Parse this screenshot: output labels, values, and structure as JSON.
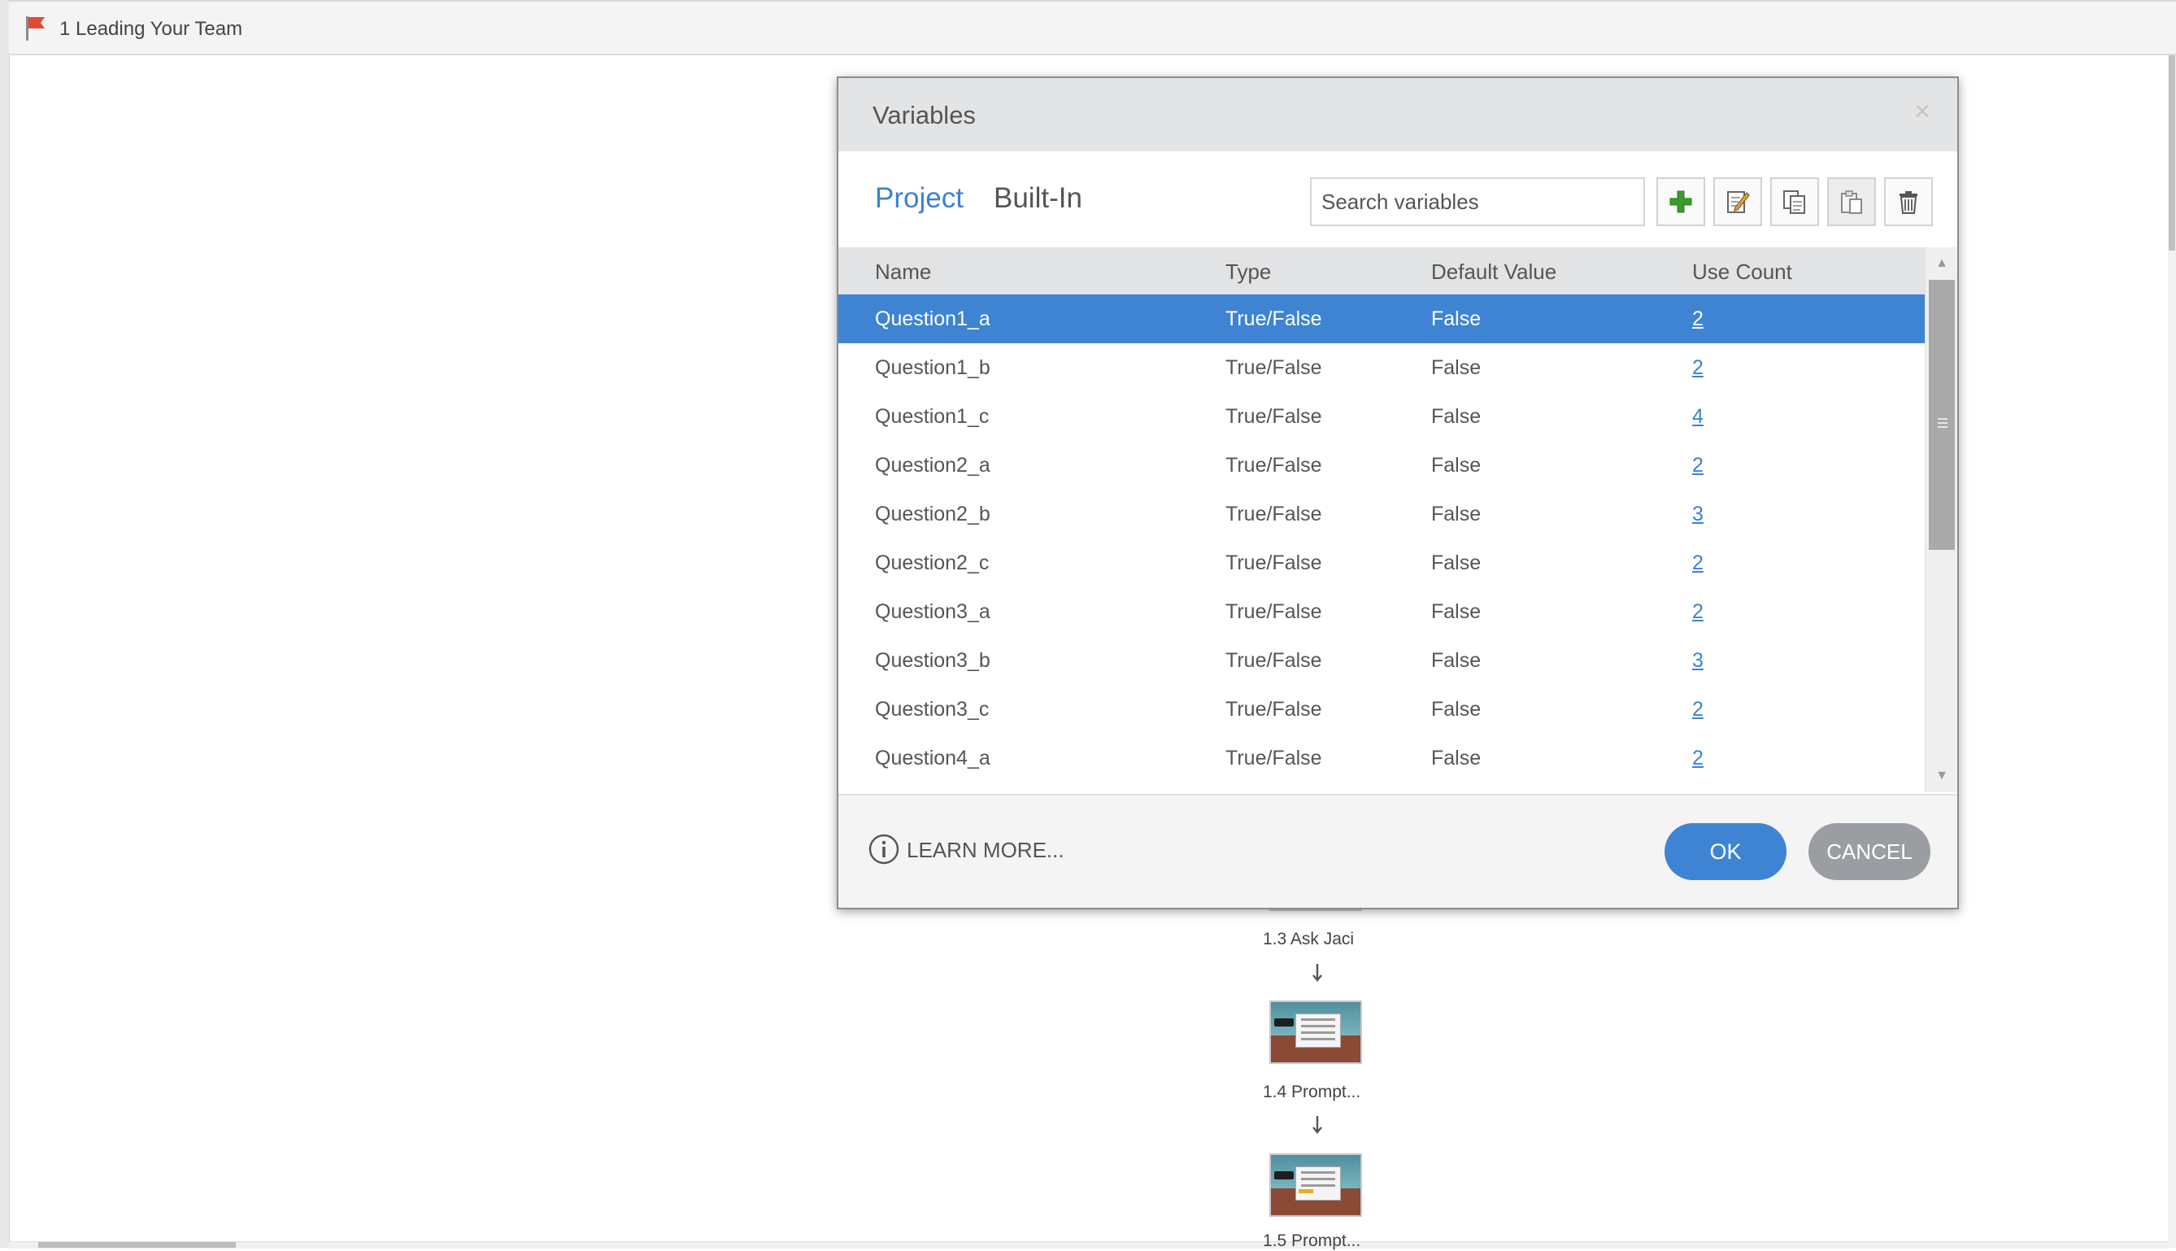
{
  "header": {
    "scene_title": "1 Leading Your Team",
    "flag_icon": "flag-icon",
    "flag_color": "#e04a3a"
  },
  "story_flow": {
    "slides": [
      {
        "label": "1.3 Ask Jaci"
      },
      {
        "label": "1.4 Prompt..."
      },
      {
        "label": "1.5 Prompt..."
      }
    ]
  },
  "dialog": {
    "title": "Variables",
    "close_icon": "close-icon",
    "tabs": [
      {
        "label": "Project",
        "active": true
      },
      {
        "label": "Built-In",
        "active": false
      }
    ],
    "search": {
      "placeholder": "Search variables",
      "value": ""
    },
    "toolbar": {
      "buttons": [
        {
          "name": "add-variable-button",
          "icon": "plus-icon"
        },
        {
          "name": "edit-variable-button",
          "icon": "edit-icon"
        },
        {
          "name": "copy-variable-button",
          "icon": "copy-icon"
        },
        {
          "name": "paste-variable-button",
          "icon": "paste-icon"
        },
        {
          "name": "delete-variable-button",
          "icon": "trash-icon"
        }
      ]
    },
    "table": {
      "columns": [
        "Name",
        "Type",
        "Default Value",
        "Use Count"
      ],
      "rows": [
        {
          "name": "Question1_a",
          "type": "True/False",
          "default": "False",
          "count": "2",
          "selected": true
        },
        {
          "name": "Question1_b",
          "type": "True/False",
          "default": "False",
          "count": "2"
        },
        {
          "name": "Question1_c",
          "type": "True/False",
          "default": "False",
          "count": "4"
        },
        {
          "name": "Question2_a",
          "type": "True/False",
          "default": "False",
          "count": "2"
        },
        {
          "name": "Question2_b",
          "type": "True/False",
          "default": "False",
          "count": "3"
        },
        {
          "name": "Question2_c",
          "type": "True/False",
          "default": "False",
          "count": "2"
        },
        {
          "name": "Question3_a",
          "type": "True/False",
          "default": "False",
          "count": "2"
        },
        {
          "name": "Question3_b",
          "type": "True/False",
          "default": "False",
          "count": "3"
        },
        {
          "name": "Question3_c",
          "type": "True/False",
          "default": "False",
          "count": "2"
        },
        {
          "name": "Question4_a",
          "type": "True/False",
          "default": "False",
          "count": "2"
        }
      ]
    },
    "footer": {
      "learn_more": "LEARN MORE...",
      "ok": "OK",
      "cancel": "CANCEL"
    },
    "colors": {
      "accent": "#3e84d3",
      "cancel": "#9a9da1",
      "add_icon": "#3a9a2a"
    }
  }
}
